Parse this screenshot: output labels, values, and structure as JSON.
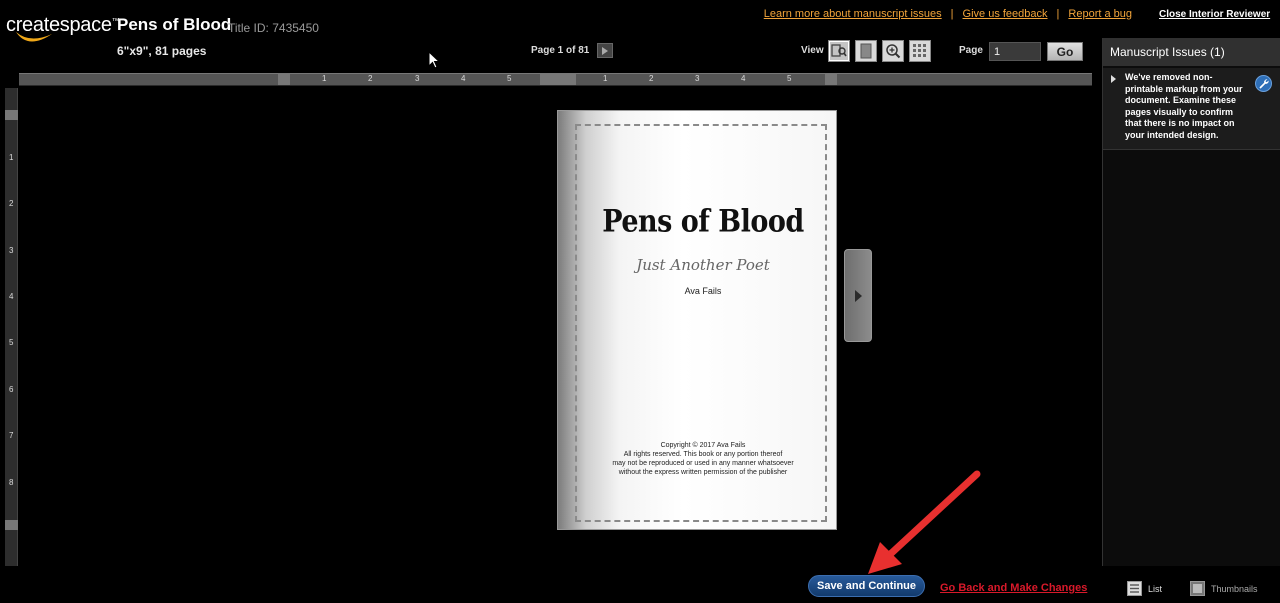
{
  "brand": {
    "logo_text": "createspace",
    "logo_tm": "™",
    "swoosh_color": "#f0a818"
  },
  "header": {
    "book_title": "Pens of Blood",
    "title_id": "Title ID: 7435450",
    "trim_info": "6\"x9\", 81 pages"
  },
  "top_links": {
    "learn_more": "Learn more about manuscript issues",
    "feedback": "Give us feedback",
    "report_bug": "Report a bug",
    "separator": "|",
    "close_reviewer": "Close Interior Reviewer",
    "link_color": "#f3a53a"
  },
  "pager": {
    "label": "Page 1 of 81"
  },
  "view_controls": {
    "label": "View",
    "buttons": [
      "magnify-page-view-icon",
      "single-page-view-icon",
      "zoom-in-view-icon",
      "grid-view-icon"
    ]
  },
  "page_jump": {
    "label": "Page",
    "value": "1",
    "go_label": "Go"
  },
  "ruler": {
    "horizontal_numbers": [
      "1",
      "2",
      "3",
      "4",
      "5",
      "1",
      "2",
      "3",
      "4",
      "5"
    ],
    "vertical_numbers": [
      "1",
      "2",
      "3",
      "4",
      "5",
      "6",
      "7",
      "8"
    ]
  },
  "book_page": {
    "title": "Pens of Blood",
    "subtitle": "Just Another Poet",
    "author": "Ava Fails",
    "copyright_lines": [
      "Copyright © 2017 Ava Fails",
      "All rights reserved. This book or any portion thereof",
      "may not be reproduced or used in any manner whatsoever",
      "without the express written permission of the publisher"
    ]
  },
  "issues_panel": {
    "heading": "Manuscript Issues (1)",
    "items": [
      {
        "text": "We've removed non-printable markup from your document. Examine these pages visually to confirm that there is no impact on your intended design."
      }
    ]
  },
  "footer": {
    "save_label": "Save and Continue",
    "go_back_label": "Go Back and Make Changes",
    "list_label": "List",
    "thumbnails_label": "Thumbnails",
    "save_color": "#1e4d8a",
    "go_back_color": "#d8192a"
  }
}
